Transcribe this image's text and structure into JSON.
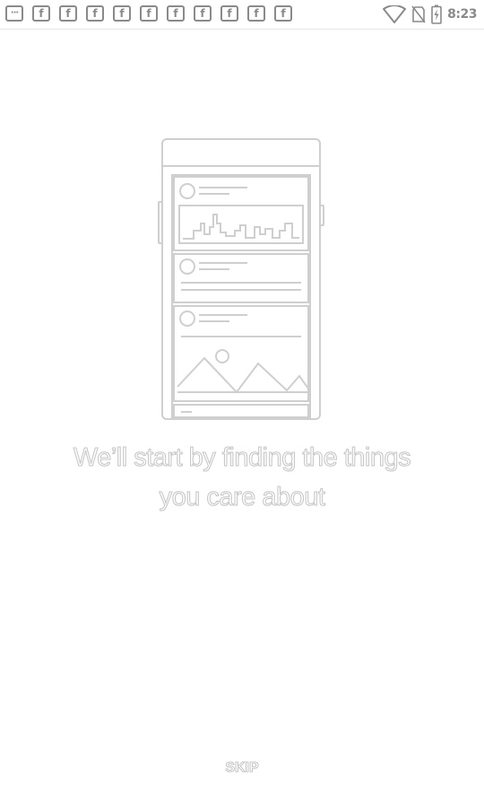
{
  "status_bar": {
    "notification_icons": [
      "more-icon",
      "facebook-icon",
      "facebook-icon",
      "facebook-icon",
      "facebook-icon",
      "facebook-icon",
      "facebook-icon",
      "facebook-icon",
      "facebook-icon",
      "facebook-icon",
      "facebook-icon",
      "facebook-icon"
    ],
    "more_glyph": "···",
    "facebook_glyph": "f",
    "time": "8:23",
    "system_icons": [
      "wifi-icon",
      "no-sim-icon",
      "battery-charging-icon"
    ]
  },
  "onboarding": {
    "headline_line1": "We’ll start by finding the things",
    "headline_line2": "you care about",
    "skip_label": "SKIP"
  }
}
